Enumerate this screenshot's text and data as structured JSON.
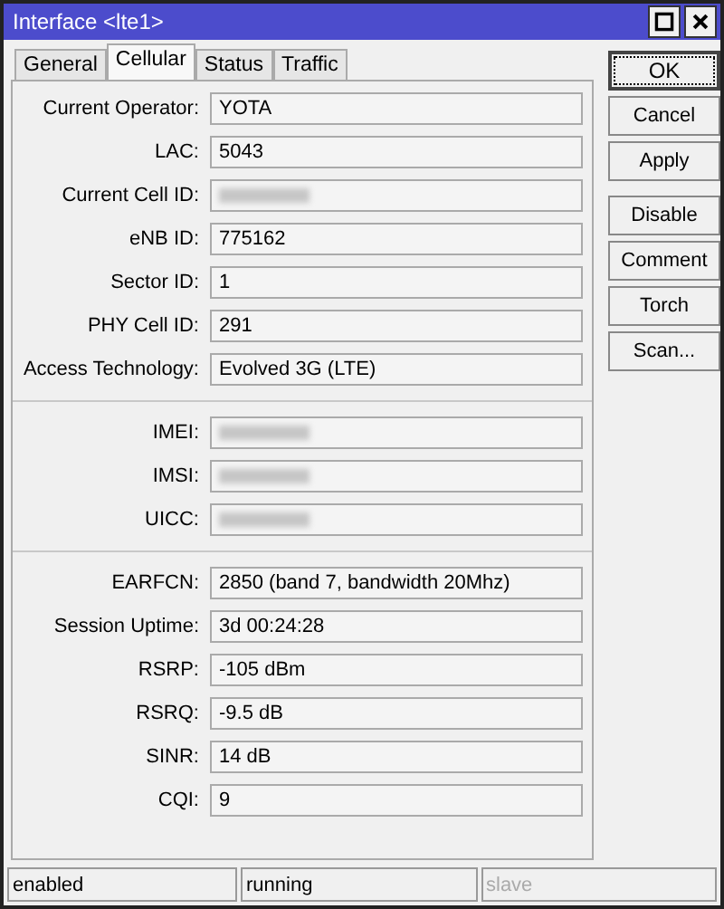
{
  "window": {
    "title": "Interface <lte1>"
  },
  "title_buttons": [
    {
      "kind": "maximize"
    },
    {
      "kind": "close"
    }
  ],
  "tabs": [
    {
      "label": "General",
      "selected": false
    },
    {
      "label": "Cellular",
      "selected": true
    },
    {
      "label": "Status",
      "selected": false
    },
    {
      "label": "Traffic",
      "selected": false
    }
  ],
  "sections": [
    {
      "fields": [
        {
          "label": "Current Operator:",
          "value": "YOTA"
        },
        {
          "label": "LAC:",
          "value": "5043"
        },
        {
          "label": "Current Cell ID:",
          "redacted": true
        },
        {
          "label": "eNB ID:",
          "value": "775162"
        },
        {
          "label": "Sector ID:",
          "value": "1"
        },
        {
          "label": "PHY Cell ID:",
          "value": "291"
        },
        {
          "label": "Access Technology:",
          "value": "Evolved 3G (LTE)"
        }
      ]
    },
    {
      "fields": [
        {
          "label": "IMEI:",
          "redacted": true
        },
        {
          "label": "IMSI:",
          "redacted": true
        },
        {
          "label": "UICC:",
          "redacted": true
        }
      ]
    },
    {
      "fields": [
        {
          "label": "EARFCN:",
          "value": "2850 (band 7, bandwidth 20Mhz)"
        },
        {
          "label": "Session Uptime:",
          "value": "3d 00:24:28"
        },
        {
          "label": "RSRP:",
          "value": "-105 dBm"
        },
        {
          "label": "RSRQ:",
          "value": "-9.5 dB"
        },
        {
          "label": "SINR:",
          "value": "14 dB"
        },
        {
          "label": "CQI:",
          "value": "9"
        }
      ]
    }
  ],
  "button_groups": [
    [
      {
        "label": "OK",
        "selected": true
      },
      {
        "label": "Cancel",
        "selected": false
      },
      {
        "label": "Apply",
        "selected": false
      }
    ],
    [
      {
        "label": "Disable",
        "selected": false
      },
      {
        "label": "Comment",
        "selected": false
      },
      {
        "label": "Torch",
        "selected": false
      },
      {
        "label": "Scan...",
        "selected": false
      }
    ]
  ],
  "status_bar": [
    {
      "text": "enabled",
      "disabled": false
    },
    {
      "text": "running",
      "disabled": false
    },
    {
      "text": "slave",
      "disabled": true
    }
  ]
}
